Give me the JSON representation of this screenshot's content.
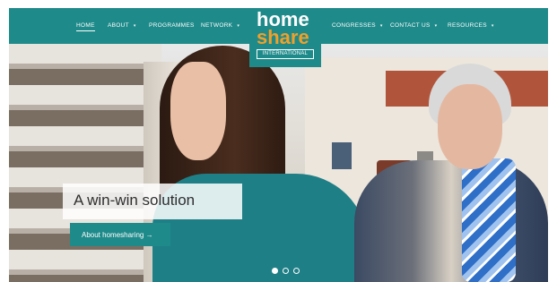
{
  "nav": {
    "items": [
      {
        "label": "HOME",
        "active": true,
        "has_caret": false
      },
      {
        "label": "ABOUT",
        "active": false,
        "has_caret": true
      },
      {
        "label": "PROGRAMMES",
        "active": false,
        "has_caret": false
      },
      {
        "label": "NETWORK",
        "active": false,
        "has_caret": true
      },
      {
        "label": "CONGRESSES",
        "active": false,
        "has_caret": true
      },
      {
        "label": "CONTACT US",
        "active": false,
        "has_caret": true
      },
      {
        "label": "RESOURCES",
        "active": false,
        "has_caret": true
      }
    ],
    "caret_glyph": "▾"
  },
  "logo": {
    "line1": "home",
    "line2": "share",
    "badge": "INTERNATIONAL"
  },
  "hero": {
    "tagline": "A win-win solution",
    "cta_label": "About homesharing →"
  },
  "carousel": {
    "total": 3,
    "active_index": 0
  },
  "colors": {
    "brand_teal": "#1f8a8a",
    "brand_orange": "#f0a02a",
    "text_dark": "#2f2f2f"
  }
}
